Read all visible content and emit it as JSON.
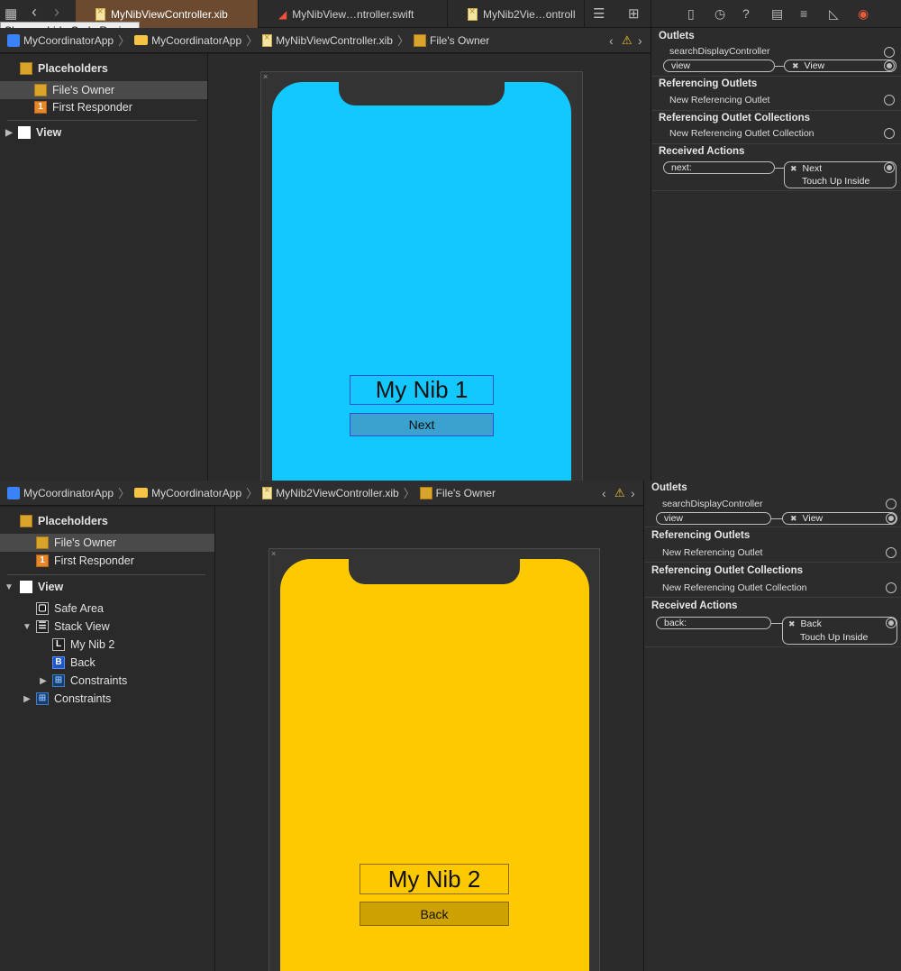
{
  "tabs": [
    {
      "label": "MyNibViewController.xib",
      "active": true
    },
    {
      "label": "MyNibView…ntroller.swift",
      "active": false
    },
    {
      "label": "MyNib2Vie…ontroll",
      "active": false
    }
  ],
  "tooltip": "Show or hide Code Review",
  "top": {
    "breadcrumb": [
      "MyCoordinatorApp",
      "MyCoordinatorApp",
      "MyNibViewController.xib",
      "File's Owner"
    ],
    "outline": {
      "placeholders": "Placeholders",
      "files_owner": "File's Owner",
      "first_responder": "First Responder",
      "view": "View"
    },
    "label_text": "My Nib 1",
    "button_text": "Next",
    "bg_color": "#12c8ff",
    "inspector": {
      "outlets_title": "Outlets",
      "outlet_search": "searchDisplayController",
      "outlet_view": "view",
      "outlet_view_target": "View",
      "ref_outlets_title": "Referencing Outlets",
      "new_ref_outlet": "New Referencing Outlet",
      "ref_collections_title": "Referencing Outlet Collections",
      "new_ref_collection": "New Referencing Outlet Collection",
      "actions_title": "Received Actions",
      "action_name": "next:",
      "action_target": "Next",
      "action_event": "Touch Up Inside"
    }
  },
  "bottom": {
    "breadcrumb": [
      "MyCoordinatorApp",
      "MyCoordinatorApp",
      "MyNib2ViewController.xib",
      "File's Owner"
    ],
    "outline": {
      "placeholders": "Placeholders",
      "files_owner": "File's Owner",
      "first_responder": "First Responder",
      "view": "View",
      "safe_area": "Safe Area",
      "stack_view": "Stack View",
      "label": "My Nib 2",
      "button": "Back",
      "constraints_inner": "Constraints",
      "constraints_outer": "Constraints"
    },
    "label_text": "My Nib 2",
    "button_text": "Back",
    "bg_color": "#ffc900",
    "inspector": {
      "outlets_title": "Outlets",
      "outlet_search": "searchDisplayController",
      "outlet_view": "view",
      "outlet_view_target": "View",
      "ref_outlets_title": "Referencing Outlets",
      "new_ref_outlet": "New Referencing Outlet",
      "ref_collections_title": "Referencing Outlet Collections",
      "new_ref_collection": "New Referencing Outlet Collection",
      "actions_title": "Received Actions",
      "action_name": "back:",
      "action_target": "Back",
      "action_event": "Touch Up Inside"
    }
  },
  "colors": {
    "accent_blue": "#2b4fd6",
    "next_button_bg": "#3ba2cf",
    "back_button_bg": "#cca100",
    "active_tab": "#6b4a30"
  }
}
